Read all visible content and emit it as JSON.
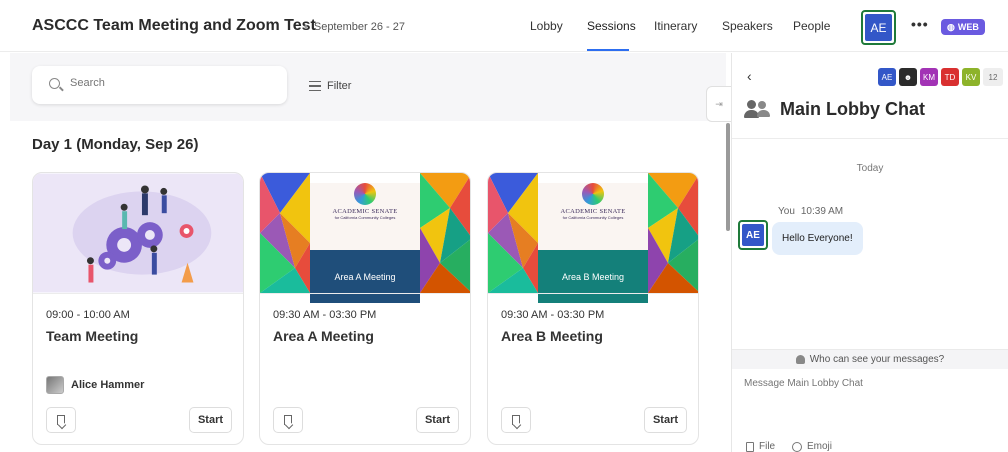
{
  "header": {
    "event_title": "ASCCC Team Meeting and Zoom Test",
    "event_dates": "September 26 - 27",
    "nav": [
      "Lobby",
      "Sessions",
      "Itinerary",
      "Speakers",
      "People"
    ],
    "active_nav": "Sessions",
    "user_initials": "AE",
    "more_label": "•••",
    "web_badge": "WEB"
  },
  "sessions": {
    "search_placeholder": "Search",
    "filter_label": "Filter",
    "day_heading": "Day 1 (Monday, Sep 26)",
    "cards": [
      {
        "time": "09:00 - 10:00 AM",
        "title": "Team Meeting",
        "host": "Alice Hammer",
        "start_label": "Start"
      },
      {
        "time": "09:30 AM - 03:30 PM",
        "title": "Area A Meeting",
        "banner_org": "ACADEMIC SENATE",
        "banner_sub": "for California Community Colleges",
        "banner_label": "Area A Meeting",
        "start_label": "Start"
      },
      {
        "time": "09:30 AM - 03:30 PM",
        "title": "Area B Meeting",
        "banner_org": "ACADEMIC SENATE",
        "banner_sub": "for California Community Colleges",
        "banner_label": "Area B Meeting",
        "start_label": "Start"
      }
    ]
  },
  "chat": {
    "back_icon": "chevron-left-icon",
    "participants": [
      {
        "initials": "AE",
        "color": "#3357c8"
      },
      {
        "initials": "",
        "color": "#2b2b2b"
      },
      {
        "initials": "KM",
        "color": "#a233b5"
      },
      {
        "initials": "TD",
        "color": "#d93030"
      },
      {
        "initials": "KV",
        "color": "#8db32a"
      }
    ],
    "participant_count": "12",
    "title": "Main Lobby Chat",
    "day_separator": "Today",
    "messages": [
      {
        "sender": "You",
        "time": "10:39 AM",
        "initials": "AE",
        "text": "Hello Everyone!"
      }
    ],
    "visibility_text": "Who can see your messages?",
    "compose_placeholder": "Message Main Lobby Chat",
    "file_label": "File",
    "emoji_label": "Emoji"
  },
  "colors": {
    "accent": "#2d6ef0",
    "avatar_blue": "#3357c8",
    "avatar_border": "#1f7a3a",
    "area_a_banner": "#1f4e7a",
    "area_b_banner": "#14807a",
    "bubble": "#e3eefb"
  }
}
